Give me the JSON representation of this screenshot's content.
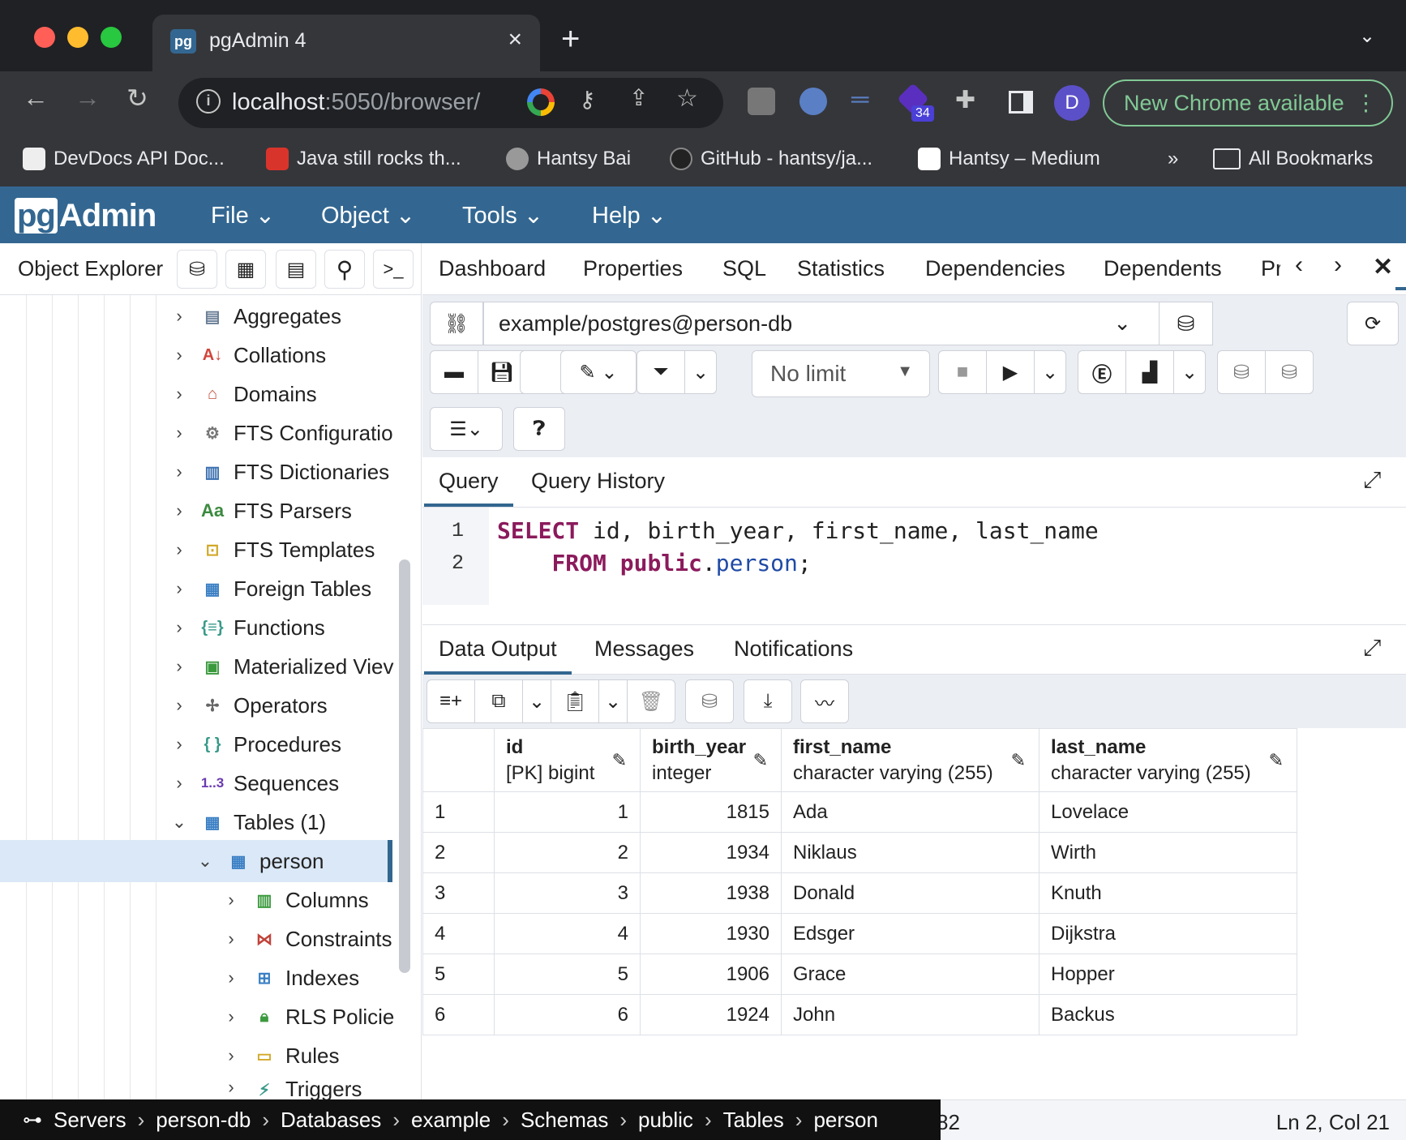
{
  "browser": {
    "tab_title": "pgAdmin 4",
    "tab_favicon": "pg",
    "address_host": "localhost",
    "address_rest": ":5050/browser/",
    "avatar_letter": "D",
    "ext_badge": "34",
    "new_chrome": "New Chrome available",
    "bookmarks": [
      {
        "label": "DevDocs API Doc..."
      },
      {
        "label": "Java still rocks th..."
      },
      {
        "label": "Hantsy Bai"
      },
      {
        "label": "GitHub - hantsy/ja..."
      },
      {
        "label": "Hantsy – Medium"
      }
    ],
    "bookmarks_more": "»",
    "all_bookmarks": "All Bookmarks"
  },
  "pgadmin": {
    "logo_pg": "pg",
    "logo_admin": "Admin",
    "menus": [
      "File",
      "Object",
      "Tools",
      "Help"
    ]
  },
  "explorer": {
    "title": "Object Explorer",
    "items": [
      {
        "label": "Aggregates",
        "icon": "aggregates-icon"
      },
      {
        "label": "Collations",
        "icon": "collations-icon"
      },
      {
        "label": "Domains",
        "icon": "domains-icon"
      },
      {
        "label": "FTS Configuratio",
        "icon": "fts-configuration-icon"
      },
      {
        "label": "FTS Dictionaries",
        "icon": "fts-dictionaries-icon"
      },
      {
        "label": "FTS Parsers",
        "icon": "fts-parsers-icon",
        "glyph": "Aa"
      },
      {
        "label": "FTS Templates",
        "icon": "fts-templates-icon"
      },
      {
        "label": "Foreign Tables",
        "icon": "foreign-tables-icon"
      },
      {
        "label": "Functions",
        "icon": "functions-icon"
      },
      {
        "label": "Materialized Viev",
        "icon": "materialized-views-icon"
      },
      {
        "label": "Operators",
        "icon": "operators-icon"
      },
      {
        "label": "Procedures",
        "icon": "procedures-icon"
      },
      {
        "label": "Sequences",
        "icon": "sequences-icon",
        "glyph": "1..3"
      },
      {
        "label": "Tables (1)",
        "icon": "tables-icon"
      },
      {
        "label": "person",
        "icon": "table-icon"
      },
      {
        "label": "Columns",
        "icon": "columns-icon"
      },
      {
        "label": "Constraints",
        "icon": "constraints-icon"
      },
      {
        "label": "Indexes",
        "icon": "indexes-icon"
      },
      {
        "label": "RLS Policie",
        "icon": "rls-policies-icon"
      },
      {
        "label": "Rules",
        "icon": "rules-icon"
      },
      {
        "label": "Triggers",
        "icon": "triggers-icon"
      }
    ]
  },
  "right": {
    "tabs": [
      "Dashboard",
      "Properties",
      "SQL",
      "Statistics",
      "Dependencies",
      "Dependents",
      "Pr"
    ],
    "connection": "example/postgres@person-db",
    "limit": "No limit",
    "query_tabs": [
      "Query",
      "Query History"
    ],
    "line_numbers": [
      "1",
      "2"
    ],
    "sql": {
      "l1_kw": "SELECT",
      "l1_rest": " id, birth_year, first_name, last_name",
      "l2_kw": "FROM",
      "l2_schema": "public",
      "l2_dot": ".",
      "l2_table": "person",
      "l2_end": ";"
    },
    "output_tabs": [
      "Data Output",
      "Messages",
      "Notifications"
    ],
    "columns": [
      {
        "name": "id",
        "type": "[PK] bigint"
      },
      {
        "name": "birth_year",
        "type": "integer"
      },
      {
        "name": "first_name",
        "type": "character varying (255)"
      },
      {
        "name": "last_name",
        "type": "character varying (255)"
      }
    ],
    "rows": [
      [
        "1",
        "1",
        "1815",
        "Ada",
        "Lovelace"
      ],
      [
        "2",
        "2",
        "1934",
        "Niklaus",
        "Wirth"
      ],
      [
        "3",
        "3",
        "1938",
        "Donald",
        "Knuth"
      ],
      [
        "4",
        "4",
        "1930",
        "Edsger",
        "Dijkstra"
      ],
      [
        "5",
        "5",
        "1906",
        "Grace",
        "Hopper"
      ],
      [
        "6",
        "6",
        "1924",
        "John",
        "Backus"
      ]
    ]
  },
  "status": {
    "breadcrumb": [
      "Servers",
      "person-db",
      "Databases",
      "example",
      "Schemas",
      "public",
      "Tables",
      "person"
    ],
    "partial_count": "82",
    "cursor": "Ln 2, Col 21"
  }
}
